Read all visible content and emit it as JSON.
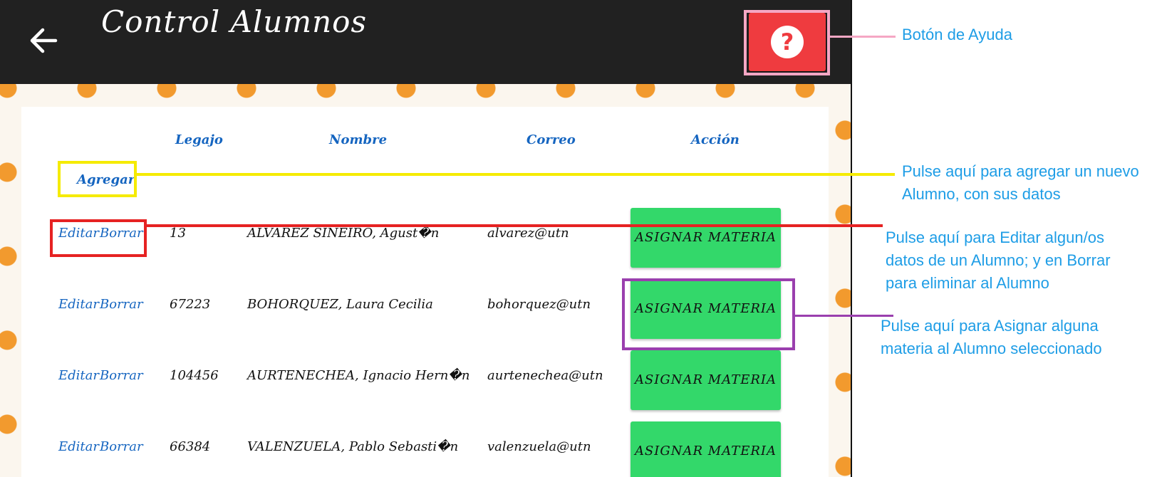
{
  "header": {
    "title": "Control Alumnos",
    "back_icon": "arrow-left-icon",
    "help_icon": "question-circle-icon"
  },
  "table": {
    "columns": [
      "Legajo",
      "Nombre",
      "Correo",
      "Acción"
    ],
    "add_label": "Agregar",
    "edit_label": "Editar",
    "delete_label": "Borrar",
    "action_label": "ASIGNAR MATERIA",
    "rows": [
      {
        "legajo": "13",
        "nombre": "ALVAREZ SINEIRO, Agust�n",
        "correo": "alvarez@utn"
      },
      {
        "legajo": "67223",
        "nombre": "BOHORQUEZ, Laura Cecilia",
        "correo": "bohorquez@utn"
      },
      {
        "legajo": "104456",
        "nombre": "AURTENECHEA, Ignacio Hern�n",
        "correo": "aurtenechea@utn"
      },
      {
        "legajo": "66384",
        "nombre": "VALENZUELA, Pablo Sebasti�n",
        "correo": "valenzuela@utn"
      }
    ]
  },
  "annotations": {
    "help": "Botón de Ayuda",
    "add": "Pulse aquí para agregar un nuevo\nAlumno, con sus datos",
    "edit": "Pulse aquí para Editar algun/os\ndatos de un Alumno; y en Borrar\npara eliminar al Alumno",
    "assign": "Pulse aquí para Asignar alguna\nmateria al Alumno seleccionado"
  },
  "colors": {
    "topbar": "#212121",
    "help_button": "#ef3b3f",
    "assign_button": "#33d86a",
    "link": "#1565c0",
    "annotation_text": "#1e9de6",
    "help_marker": "#f5a7c4",
    "add_marker": "#f5eb00",
    "edit_marker": "#e62222",
    "assign_marker": "#9a3fae"
  }
}
